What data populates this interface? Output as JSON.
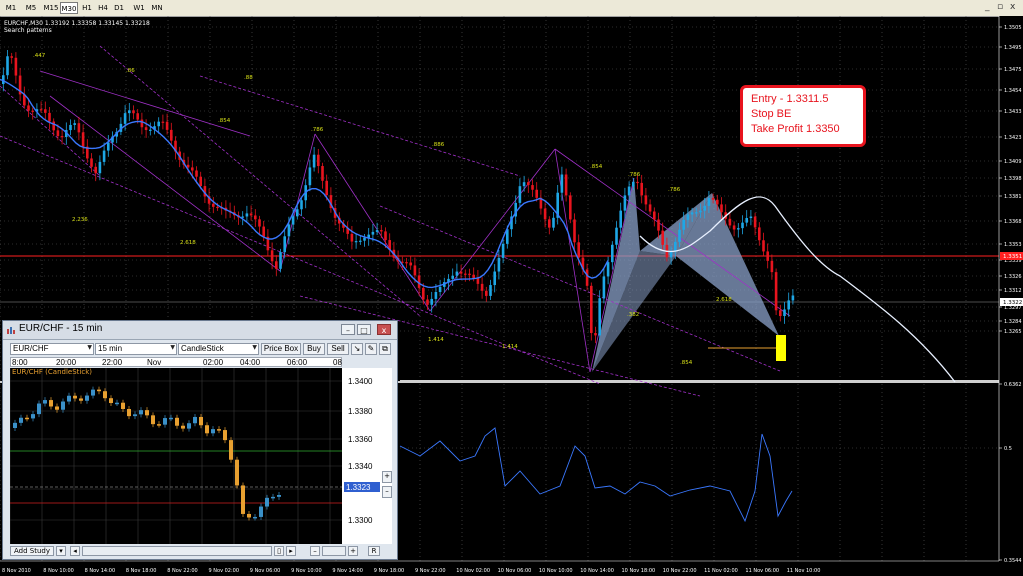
{
  "timeframes": [
    "M1",
    "M5",
    "M15",
    "M30",
    "H1",
    "H4",
    "D1",
    "W1",
    "MN"
  ],
  "selected_timeframe": "M30",
  "window_controls": {
    "minimize": "_",
    "restore": "▫",
    "close": "x"
  },
  "chart": {
    "symbol_info": "EURCHF,M30  1.33192 1.33358 1.33145 1.33218",
    "indicator": "Search patterns",
    "price_labels": [
      "1.3505",
      "1.3495",
      "1.3475",
      "1.3454",
      "1.3433",
      "1.3423",
      "1.3409",
      "1.3398",
      "1.3381",
      "1.3368",
      "1.3353",
      "1.3339",
      "1.3326",
      "1.3312",
      "1.3297",
      "1.3284",
      "1.3265",
      "0.6362",
      "0.5",
      "0.3544"
    ],
    "current_price": "1.3351",
    "bid_price": "1.3322",
    "time_labels": [
      "8 Nov 2010",
      "8 Nov 10:00",
      "8 Nov 14:00",
      "8 Nov 18:00",
      "8 Nov 22:00",
      "9 Nov 02:00",
      "9 Nov 06:00",
      "9 Nov 10:00",
      "9 Nov 14:00",
      "9 Nov 18:00",
      "9 Nov 22:00",
      "10 Nov 02:00",
      "10 Nov 06:00",
      "10 Nov 10:00",
      "10 Nov 14:00",
      "10 Nov 18:00",
      "10 Nov 22:00",
      "11 Nov 02:00",
      "11 Nov 06:00",
      "11 Nov 10:00"
    ],
    "pattern_ratios": [
      ".447",
      ".86",
      ".88",
      ".854",
      ".786",
      ".886",
      ".854",
      ".786",
      ".786",
      "2.236",
      "2.618",
      ".382",
      "2.618",
      ".854",
      "1.414",
      "1.414"
    ]
  },
  "trade_note": {
    "entry": "Entry - 1.3311.5",
    "stop": "Stop BE",
    "take_profit": "Take Profit 1.3350"
  },
  "subwindow": {
    "title": "EUR/CHF - 15 min",
    "symbol": "EUR/CHF",
    "interval": "15 min",
    "chart_type": "CandleStick",
    "price_box_button": "Price Box",
    "buy_button": "Buy",
    "sell_button": "Sell",
    "time_labels": [
      "8:00",
      "20:00",
      "22:00",
      "Nov 11",
      "02:00",
      "04:00",
      "06:00",
      "08"
    ],
    "legend": "EUR/CHF (CandleStick)",
    "price_labels": [
      "1.3400",
      "1.3380",
      "1.3360",
      "1.3340",
      "1.3320",
      "1.3300"
    ],
    "current_price": "1.3323",
    "add_study": "Add Study",
    "reset": "R"
  }
}
